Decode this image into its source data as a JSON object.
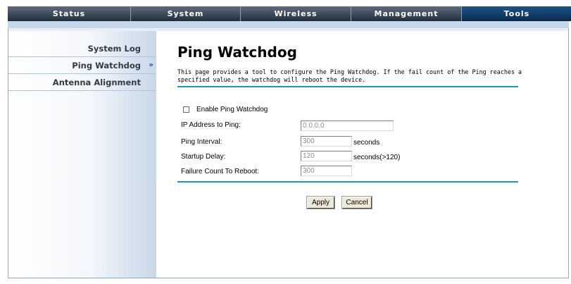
{
  "nav": {
    "tabs": [
      {
        "label": "Status",
        "active": false
      },
      {
        "label": "System",
        "active": false
      },
      {
        "label": "Wireless",
        "active": false
      },
      {
        "label": "Management",
        "active": false
      },
      {
        "label": "Tools",
        "active": true
      }
    ]
  },
  "sidebar": {
    "items": [
      {
        "label": "System Log",
        "selected": false
      },
      {
        "label": "Ping Watchdog",
        "selected": true
      },
      {
        "label": "Antenna Alignment",
        "selected": false
      }
    ],
    "selected_marker": "»"
  },
  "main": {
    "title": "Ping Watchdog",
    "description": "This page provides a tool to configure the Ping Watchdog. If the fail count of the Ping reaches a specified value, the watchdog will reboot the device.",
    "enable_label": "Enable Ping Watchdog",
    "enable_checked": false,
    "fields": {
      "ip": {
        "label": "IP Address to Ping:",
        "value": "0.0.0.0"
      },
      "interval": {
        "label": "Ping Interval:",
        "value": "300",
        "unit": "seconds"
      },
      "startup": {
        "label": "Startup Delay:",
        "value": "120",
        "unit": "seconds(>120)"
      },
      "failure": {
        "label": "Failure Count To Reboot:",
        "value": "300"
      }
    },
    "buttons": {
      "apply": "Apply",
      "cancel": "Cancel"
    }
  },
  "colors": {
    "nav_bg": "#2f3e4c",
    "nav_active": "#0f3a63",
    "accent_rule": "#1b9ac9",
    "sidebar_edge": "#c8d7e8"
  }
}
